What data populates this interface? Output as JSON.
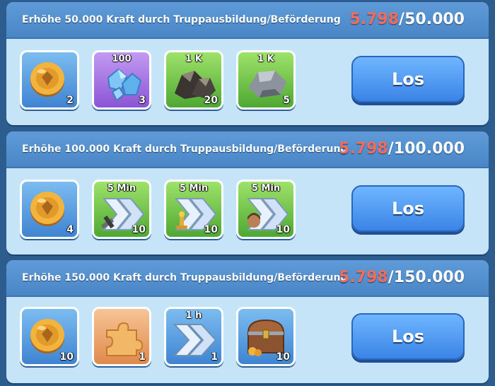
{
  "tasks": [
    {
      "title": "Erhöhe 50.000 Kraft durch Truppausbildung/Beförderung",
      "progress_current": "5.798",
      "progress_separator": "/",
      "progress_goal": "50.000",
      "button_label": "Los",
      "rewards": [
        {
          "icon": "coin-icon",
          "frame": "blue",
          "top_label": "",
          "count": "2"
        },
        {
          "icon": "crystal-icon",
          "frame": "purple",
          "top_label": "100",
          "count": "3"
        },
        {
          "icon": "coal-ore-icon",
          "frame": "green",
          "top_label": "1 K",
          "count": "20"
        },
        {
          "icon": "stone-ore-icon",
          "frame": "green",
          "top_label": "1 K",
          "count": "5"
        }
      ]
    },
    {
      "title": "Erhöhe 100.000 Kraft durch Truppausbildung/Beförderung",
      "progress_current": "5.798",
      "progress_separator": "/",
      "progress_goal": "100.000",
      "button_label": "Los",
      "rewards": [
        {
          "icon": "coin-icon",
          "frame": "blue",
          "top_label": "",
          "count": "4"
        },
        {
          "icon": "speedup-training-icon",
          "frame": "green",
          "top_label": "5 Min",
          "count": "10"
        },
        {
          "icon": "speedup-research-icon",
          "frame": "green",
          "top_label": "5 Min",
          "count": "10"
        },
        {
          "icon": "speedup-healing-icon",
          "frame": "green",
          "top_label": "5 Min",
          "count": "10"
        }
      ]
    },
    {
      "title": "Erhöhe 150.000 Kraft durch Truppausbildung/Beförderung",
      "progress_current": "5.798",
      "progress_separator": "/",
      "progress_goal": "150.000",
      "button_label": "Los",
      "rewards": [
        {
          "icon": "coin-icon",
          "frame": "blue",
          "top_label": "",
          "count": "10"
        },
        {
          "icon": "puzzle-piece-icon",
          "frame": "orange",
          "top_label": "",
          "count": "1"
        },
        {
          "icon": "speedup-icon",
          "frame": "blue",
          "top_label": "1 h",
          "count": "1"
        },
        {
          "icon": "treasure-chest-icon",
          "frame": "blue",
          "top_label": "",
          "count": "10"
        }
      ]
    }
  ],
  "colors": {
    "progress_current": "#f26b5b",
    "panel_bg": "#c6e4f8",
    "header_bg": "#4a86c6",
    "button_bg": "#3a84e6",
    "page_bg": "#2d5d8f"
  }
}
